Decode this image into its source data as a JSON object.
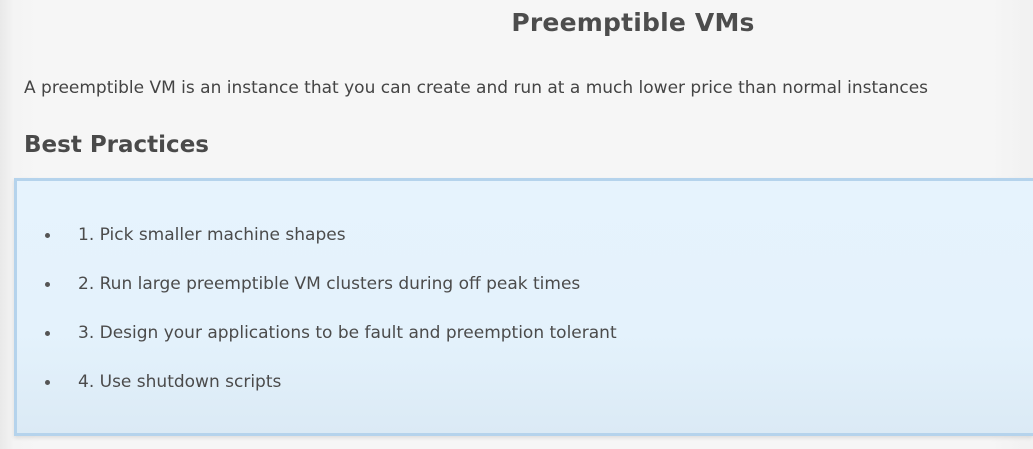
{
  "slide": {
    "title": "Preemptible VMs",
    "intro": "A preemptible VM is an instance that you can create and run at a much lower price than normal instances",
    "section_heading": "Best Practices",
    "practices": [
      "1. Pick smaller machine shapes",
      "2. Run large preemptible VM clusters during off peak times",
      "3. Design your applications to be fault and preemption tolerant",
      "4. Use shutdown scripts"
    ]
  },
  "colors": {
    "callout_background": "#e4f2fc",
    "callout_border": "#b5d3ec",
    "text": "#4a4a4a"
  },
  "icons": {
    "list_marker": "bullet-icon"
  }
}
